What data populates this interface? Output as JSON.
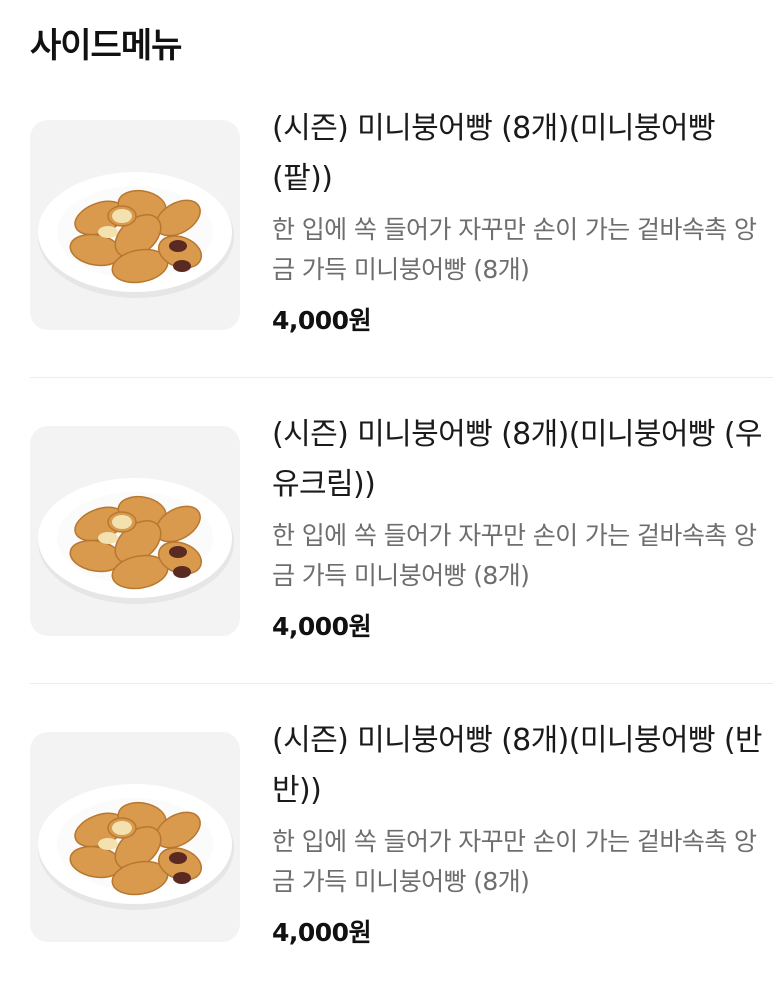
{
  "section": {
    "title": "사이드메뉴"
  },
  "items": [
    {
      "name": "(시즌) 미니붕어빵 (8개)(미니붕어빵 (팥))",
      "description": "한 입에 쏙 들어가 자꾸만 손이 가는 겉바속촉 앙금 가득 미니붕어빵 (8개)",
      "price": "4,000원",
      "image_icon": "fish-bread-plate-icon"
    },
    {
      "name": "(시즌) 미니붕어빵 (8개)(미니붕어빵 (우유크림))",
      "description": "한 입에 쏙 들어가 자꾸만 손이 가는 겉바속촉 앙금 가득 미니붕어빵 (8개)",
      "price": "4,000원",
      "image_icon": "fish-bread-plate-icon"
    },
    {
      "name": "(시즌) 미니붕어빵 (8개)(미니붕어빵 (반반))",
      "description": "한 입에 쏙 들어가 자꾸만 손이 가는 겉바속촉 앙금 가득 미니붕어빵 (8개)",
      "price": "4,000원",
      "image_icon": "fish-bread-plate-icon"
    }
  ],
  "colors": {
    "title_text": "#111111",
    "name_text": "#1a1a1a",
    "description_text": "#6e6e6e",
    "thumbnail_bg": "#f3f3f4",
    "divider": "#ececec",
    "bread": "#d99a4e",
    "bean_paste": "#5a2a22"
  }
}
